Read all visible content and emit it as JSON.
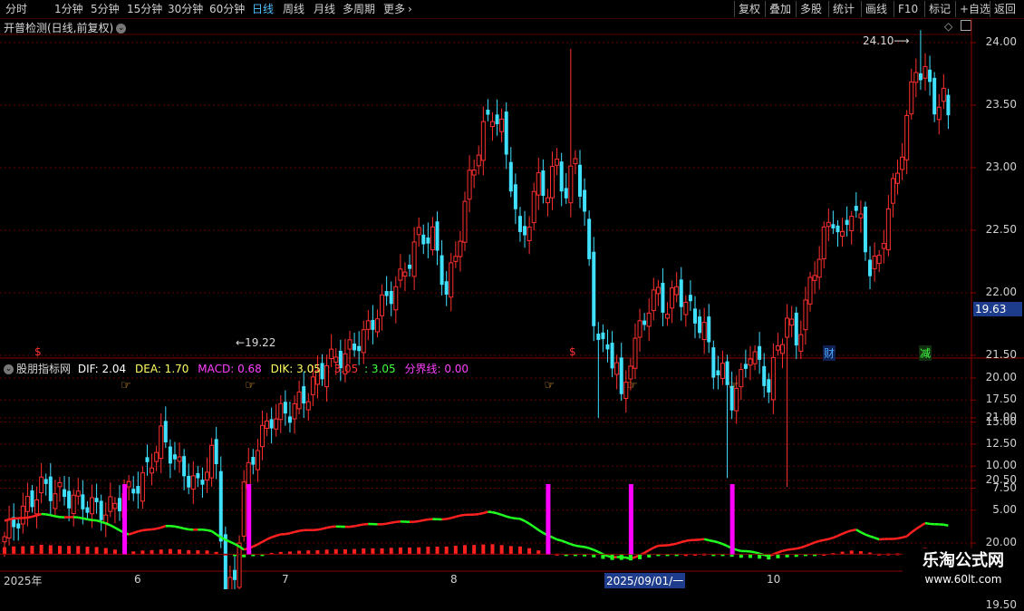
{
  "toolbar": {
    "periods": [
      "分时",
      "1分钟",
      "5分钟",
      "15分钟",
      "30分钟",
      "60分钟",
      "日线",
      "周线",
      "月线",
      "多周期",
      "更多"
    ],
    "active": "日线",
    "right_items": [
      "复权",
      "叠加",
      "多股",
      "统计",
      "画线",
      "F10",
      "标记",
      "+自选",
      "返回"
    ]
  },
  "chart_title": "开普检测(日线,前复权)",
  "main_chart": {
    "high_label": "24.10",
    "low_label": "19.22",
    "current_price": "19.63",
    "y_ticks": [
      "24.00",
      "23.50",
      "23.00",
      "22.50",
      "22.00",
      "21.50",
      "21.00",
      "20.50",
      "20.00",
      "19.50"
    ],
    "tags": [
      {
        "text": "$",
        "color": "#ff3030"
      },
      {
        "text": "$",
        "color": "#ff3030"
      },
      {
        "text": "财",
        "color": "#4aa8ff"
      },
      {
        "text": "减",
        "color": "#40ff40"
      }
    ]
  },
  "indicator": {
    "name": "股朋指标网",
    "dif_text": "DIF: 2.04",
    "dea_text": "DEA: 1.70",
    "macd_text": "MACD: 0.68",
    "dik_text": "DIK: 3.05",
    "val2_text": ": 3.05",
    "val3_text": ": 3.05",
    "boundary_text": "分界线: 0.00",
    "y_ticks": [
      "20.00",
      "17.50",
      "15.00",
      "12.50",
      "10.00",
      "7.50",
      "5.00"
    ]
  },
  "date_axis": {
    "labels": [
      "2025年",
      "6",
      "7",
      "8",
      "2025/09/01/一",
      "10"
    ]
  },
  "watermark": {
    "line1": "乐淘公式网",
    "line2": "www.60lt.com"
  },
  "colors": {
    "up": "#ff3030",
    "down": "#40e0ff",
    "dif_up": "#ff2020",
    "dif_down": "#20ff20",
    "magenta": "#ff00ff",
    "price_box": "#1e3c8c"
  }
}
